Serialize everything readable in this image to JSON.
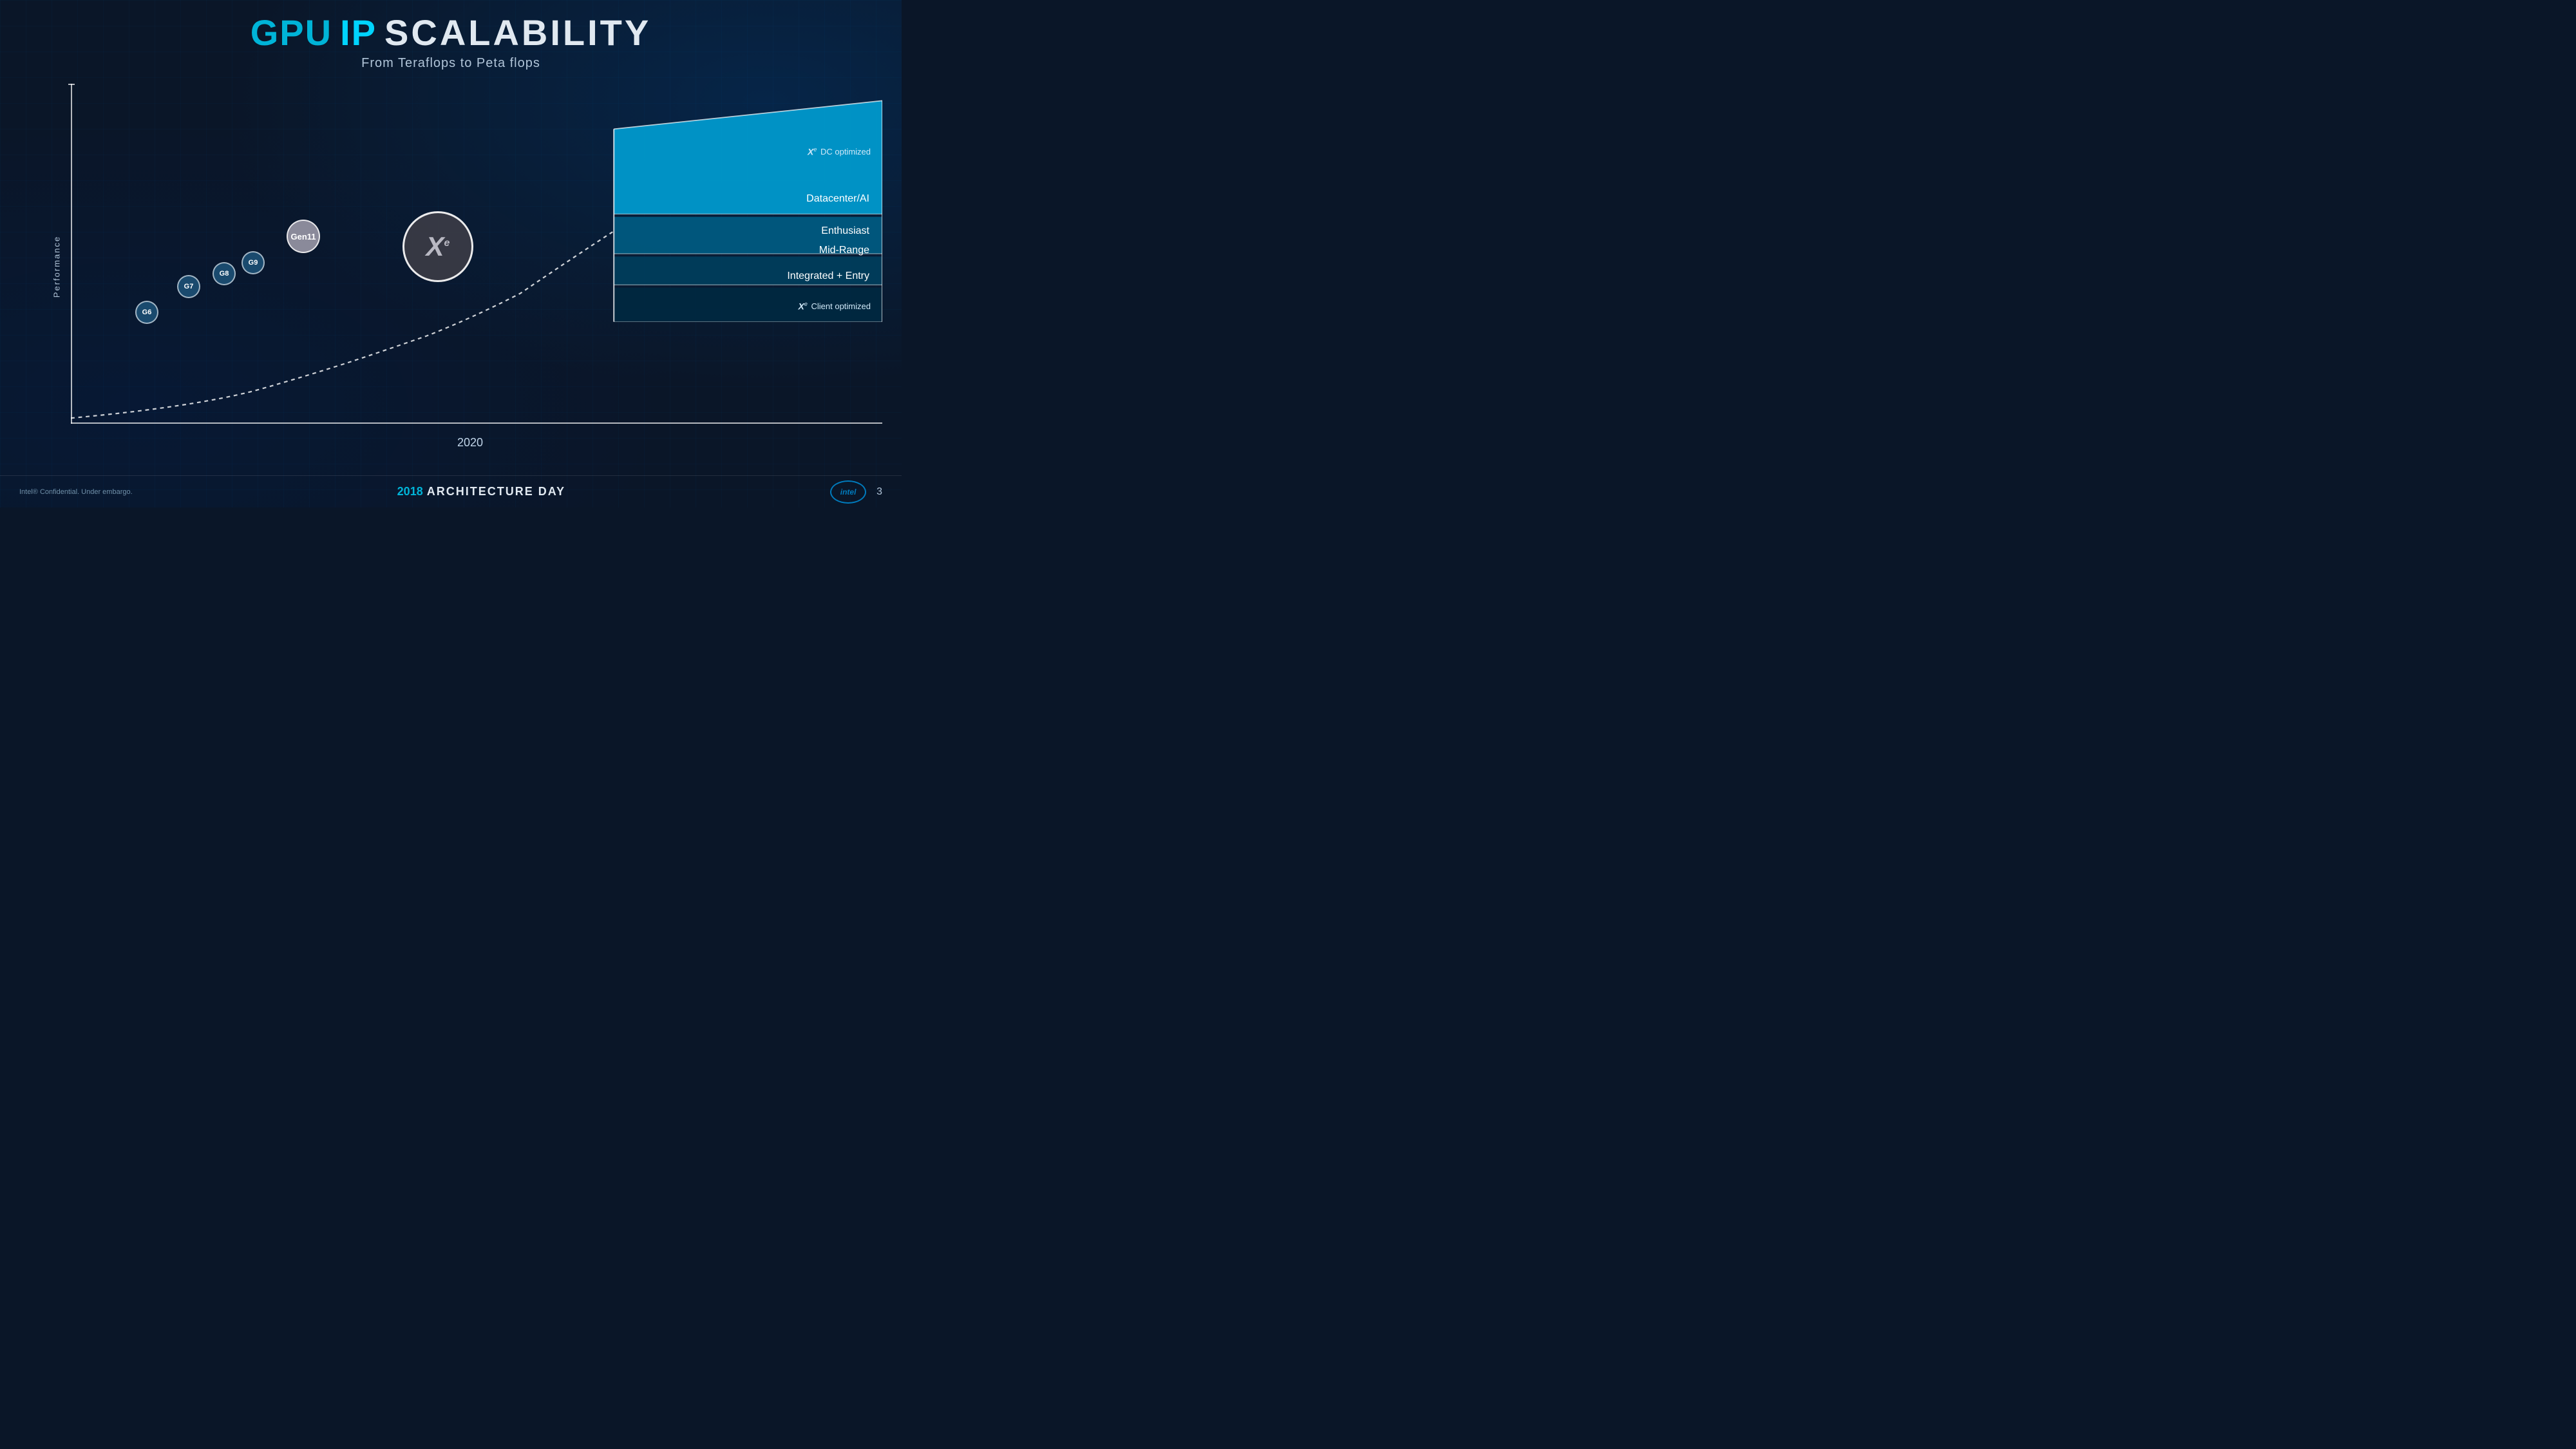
{
  "header": {
    "title_gpu": "GPU",
    "title_ip": "IP",
    "title_scalability": "SCALABILITY",
    "subtitle": "From Teraflops to Peta flops"
  },
  "chart": {
    "y_axis_label": "Performance",
    "x_axis_year": "2020",
    "generations": [
      {
        "id": "G6",
        "label": "G6"
      },
      {
        "id": "G7",
        "label": "G7"
      },
      {
        "id": "G8",
        "label": "G8"
      },
      {
        "id": "G9",
        "label": "G9"
      },
      {
        "id": "Gen11",
        "label": "Gen11"
      },
      {
        "id": "Xe",
        "label": "X"
      }
    ],
    "tiers": [
      {
        "id": "datacenter",
        "label": "Datacenter/AI",
        "color": "#00b4d8"
      },
      {
        "id": "enthusiast",
        "label": "Enthusiast",
        "color": "#006080"
      },
      {
        "id": "midrange",
        "label": "Mid-Range",
        "color": "#004060"
      },
      {
        "id": "integrated",
        "label": "Integrated + Entry",
        "color": "#002840"
      }
    ],
    "dc_optimized_label": "DC optimized",
    "client_optimized_label": "Client optimized",
    "xe_superscript": "e"
  },
  "footer": {
    "confidential": "Intel® Confidential. Under embargo.",
    "year": "2018",
    "event": "ARCHITECTURE DAY",
    "intel_logo": "intel",
    "page_number": "3"
  }
}
